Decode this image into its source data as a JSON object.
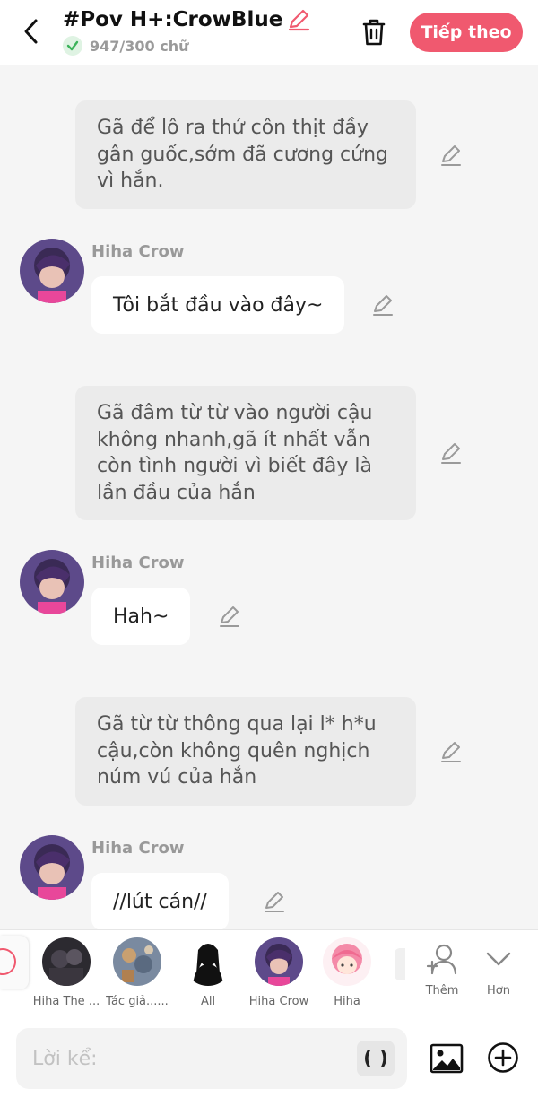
{
  "header": {
    "title": "#Pov H+:CrowBlue",
    "word_count": "947/300 chữ",
    "next_label": "Tiếp theo",
    "accent_color": "#f0596f"
  },
  "messages": [
    {
      "type": "narration",
      "text": "Gã để lô ra thứ côn thịt đầy gân guốc,sớm đã cương cứng vì hắn."
    },
    {
      "type": "dialogue",
      "name": "Hiha Crow",
      "text": "Tôi bắt đầu vào đây~"
    },
    {
      "type": "narration",
      "text": "Gã đâm từ từ vào người cậu không nhanh,gã ít nhất vẫn còn tình người vì biết đây là lần đầu của hắn"
    },
    {
      "type": "dialogue",
      "name": "Hiha Crow",
      "text": "Hah~"
    },
    {
      "type": "narration",
      "text": "Gã từ từ thông qua lại l* h*u cậu,còn không quên nghịch núm vú của hắn"
    },
    {
      "type": "dialogue",
      "name": "Hiha Crow",
      "text": "//lút cán//"
    }
  ],
  "characters": [
    {
      "label": "Hiha The ...",
      "icon": "avatar-dark-group"
    },
    {
      "label": "Tác giả......",
      "icon": "avatar-author"
    },
    {
      "label": "All",
      "icon": "avatar-silhouette"
    },
    {
      "label": "Hiha Crow",
      "icon": "avatar-hiha-crow"
    },
    {
      "label": "Hiha",
      "icon": "avatar-pink-hair"
    }
  ],
  "side_buttons": {
    "add_label": "Thêm",
    "more_label": "Hơn"
  },
  "input": {
    "placeholder": "Lời kể:",
    "paren_label": "( )"
  }
}
